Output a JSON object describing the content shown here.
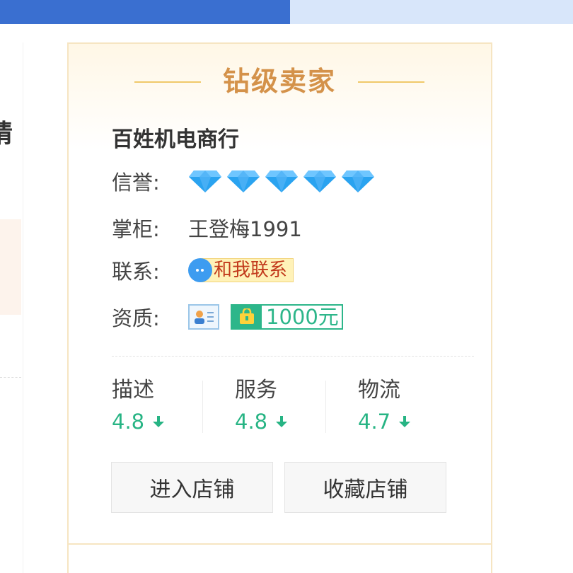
{
  "left_fragment": {
    "glyph": "猜"
  },
  "seller_card": {
    "badge_title": "钻级卖家",
    "shop_name": "百姓机电商行",
    "credit": {
      "label": "信誉:",
      "diamonds": 5,
      "icon": "diamond-icon",
      "color": "#2aa3f0"
    },
    "owner": {
      "label": "掌柜:",
      "name": "王登梅1991"
    },
    "contact": {
      "label": "联系:",
      "button_label": "和我联系",
      "icon": "chat-bubble-icon"
    },
    "qualification": {
      "label": "资质:",
      "deposit_label": "1000元",
      "id_icon": "id-card-icon",
      "deposit_icon": "shopping-bag-icon"
    },
    "ratings": [
      {
        "label": "描述",
        "score": "4.8",
        "trend_icon": "arrow-down-icon"
      },
      {
        "label": "服务",
        "score": "4.8",
        "trend_icon": "arrow-down-icon"
      },
      {
        "label": "物流",
        "score": "4.7",
        "trend_icon": "arrow-down-icon"
      }
    ],
    "buttons": {
      "enter_shop": "进入店铺",
      "favorite_shop": "收藏店铺"
    }
  },
  "colors": {
    "accent_blue": "#3a6fd0",
    "badge_gold": "#d4924a",
    "score_green": "#27b484",
    "contact_red": "#c23a1c"
  }
}
